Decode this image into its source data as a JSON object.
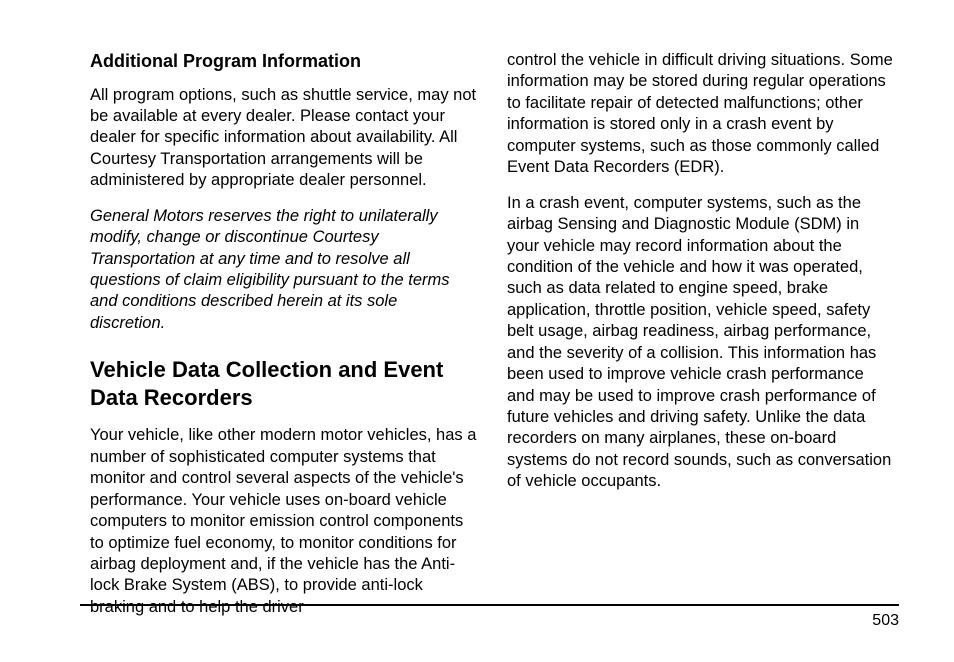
{
  "left": {
    "heading1": "Additional Program Information",
    "para1": "All program options, such as shuttle service, may not be available at every dealer. Please contact your dealer for specific information about availability. All Courtesy Transportation arrangements will be administered by appropriate dealer personnel.",
    "para2_italic": "General Motors reserves the right to unilaterally modify, change or discontinue Courtesy Transportation at any time and to resolve all questions of claim eligibility pursuant to the terms and conditions described herein at its sole discretion.",
    "heading2": "Vehicle Data Collection and Event Data Recorders",
    "para3": "Your vehicle, like other modern motor vehicles, has a number of sophisticated computer systems that monitor and control several aspects of the vehicle's performance. Your vehicle uses on-board vehicle computers to monitor emission control components to optimize fuel economy, to monitor conditions for airbag deployment and, if the vehicle has the Anti-lock Brake System (ABS), to provide anti-lock braking and to help the driver"
  },
  "right": {
    "para1": "control the vehicle in difficult driving situations. Some information may be stored during regular operations to facilitate repair of detected malfunctions; other information is stored only in a crash event by computer systems, such as those commonly called Event Data Recorders (EDR).",
    "para2": "In a crash event, computer systems, such as the airbag Sensing and Diagnostic Module (SDM) in your vehicle may record information about the condition of the vehicle and how it was operated, such as data related to engine speed, brake application, throttle position, vehicle speed, safety belt usage, airbag readiness, airbag performance, and the severity of a collision. This information has been used to improve vehicle crash performance and may be used to improve crash performance of future vehicles and driving safety. Unlike the data recorders on many airplanes, these on-board systems do not record sounds, such as conversation of vehicle occupants."
  },
  "page_number": "503"
}
